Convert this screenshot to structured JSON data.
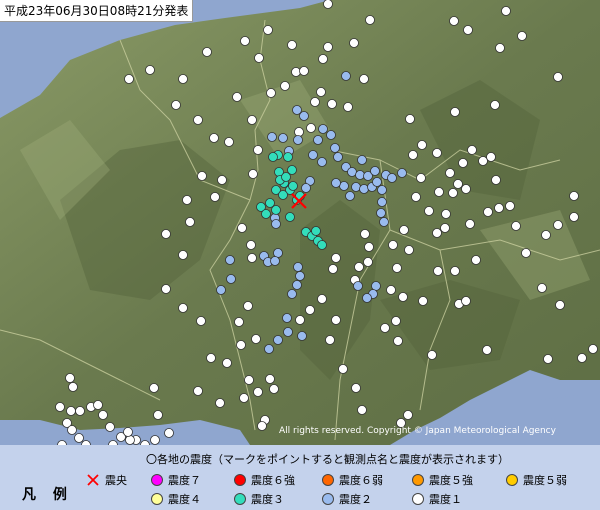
{
  "title": "平成23年06月30日08時21分発表",
  "copyright": "All rights reserved. Copyright © Japan Meteorological Agency",
  "legend": {
    "heading": "凡 例",
    "note": "〇各地の震度（マークをポイントすると観測点名と震度が表示されます）",
    "epicenter_label": "震央",
    "items": [
      {
        "label": "震度７",
        "color": "#ff00ff"
      },
      {
        "label": "震度６強",
        "color": "#ff0000"
      },
      {
        "label": "震度６弱",
        "color": "#ff6600"
      },
      {
        "label": "震度５強",
        "color": "#ff9900"
      },
      {
        "label": "震度５弱",
        "color": "#ffcc00"
      },
      {
        "label": "震度４",
        "color": "#ffff99"
      },
      {
        "label": "震度３",
        "color": "#33ddbb"
      },
      {
        "label": "震度２",
        "color": "#99bbee"
      },
      {
        "label": "震度１",
        "color": "#ffffff"
      }
    ]
  },
  "colors": {
    "intensity3": "#33ddbb",
    "intensity2": "#99bbee",
    "intensity1": "#ffffff",
    "epicenter": "#ff0000",
    "sea": "#8fa6cf",
    "land": "#6f7d52"
  },
  "map_data": {
    "epicenter": "x-mark",
    "station_intensities": {
      "intensity3_count": 24,
      "intensity2_count": 58,
      "intensity1_count": 150
    }
  }
}
